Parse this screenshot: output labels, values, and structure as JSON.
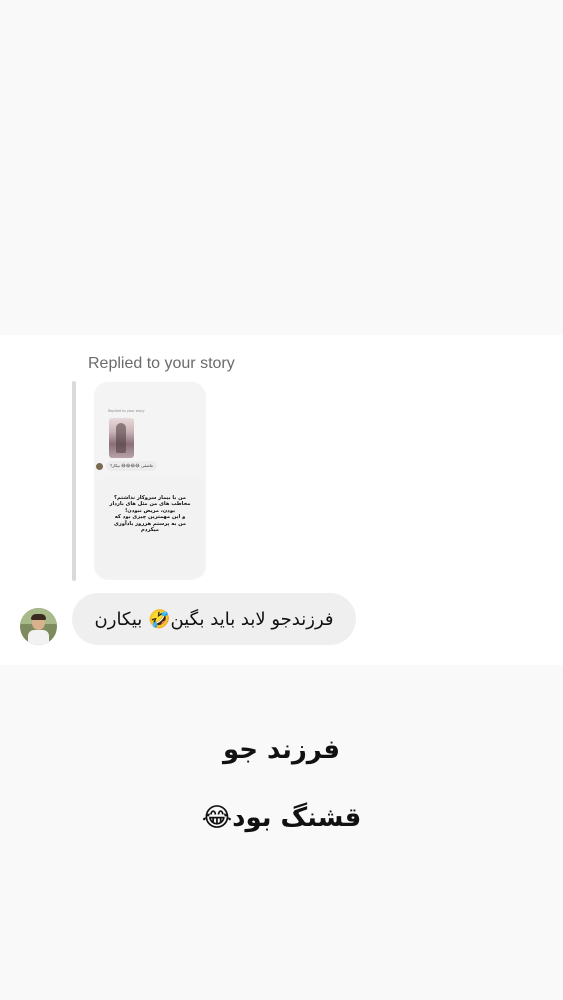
{
  "dm": {
    "replied_label": "Replied to your story",
    "story_preview": {
      "mini_header": "Replied to your story",
      "mini_reply": "عاشقی 😂😂😂😂 بیکار؟",
      "note_text": "من با بیمار سروکار نداشتم؟\nمخاطب های من مثل های باردار\nبودن، مریض نبودن!\nو این مهمترین چیزی بود که\nمن به پرستم هرروز یادآوری\nمیکردم"
    },
    "message_text": "فرزندجو لابد باید بگین🤣 بیکارن"
  },
  "caption": {
    "line1": "فرزند جو",
    "line2": "قشنگ بود😂"
  }
}
